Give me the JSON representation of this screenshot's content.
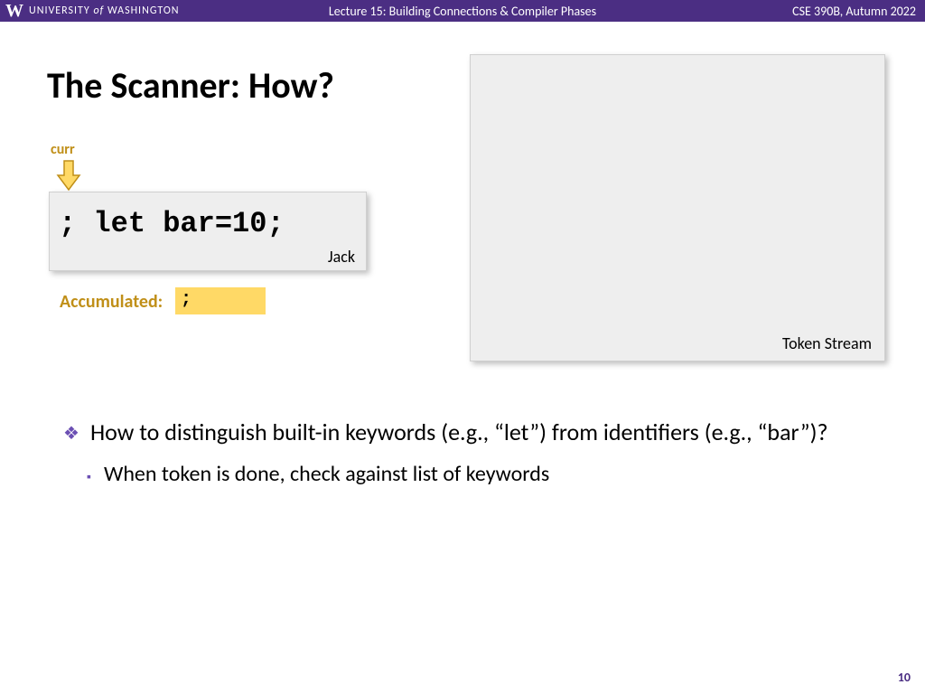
{
  "header": {
    "university": "UNIVERSITY of WASHINGTON",
    "lecture_title": "Lecture 15: Building Connections & Compiler Phases",
    "course": "CSE 390B, Autumn 2022"
  },
  "slide": {
    "title": "The Scanner: How?",
    "curr_label": "curr",
    "code": "; let bar=10;",
    "code_lang": "Jack",
    "accum_label": "Accumulated:",
    "accum_value": ";",
    "token_stream_label": "Token Stream"
  },
  "bullets": {
    "main": "How to distinguish built-in keywords (e.g., “let”) from identifiers (e.g., “bar”)?",
    "sub": "When token is done, check against list of keywords"
  },
  "page_number": "10"
}
